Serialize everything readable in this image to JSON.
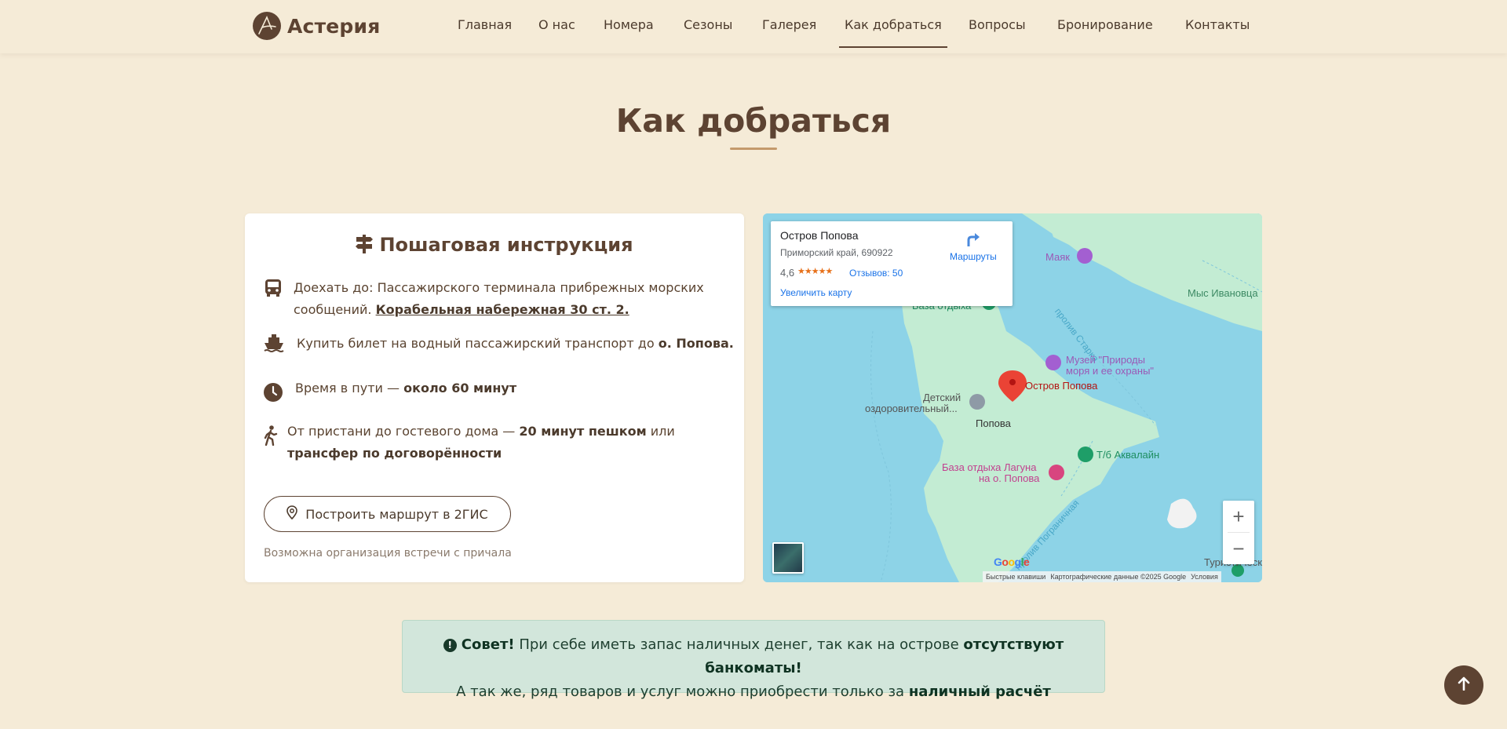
{
  "header": {
    "brand": "Астерия",
    "nav": [
      {
        "label": "Главная"
      },
      {
        "label": "О нас"
      },
      {
        "label": "Номера"
      },
      {
        "label": "Сезоны"
      },
      {
        "label": "Галерея"
      },
      {
        "label": "Как добраться",
        "active": true
      },
      {
        "label": "Вопросы"
      },
      {
        "label": "Бронирование"
      },
      {
        "label": "Контакты"
      }
    ]
  },
  "page": {
    "title": "Как добраться"
  },
  "instructions": {
    "title": "Пошаговая инструкция",
    "step1": {
      "text": "Доехать до: Пассажирского терминала прибрежных морских сообщений. ",
      "link": "Корабельная набережная 30 ст. 2."
    },
    "step2": {
      "text": "Купить билет на водный пассажирский транспорт до ",
      "bold": "о. Попова."
    },
    "step3": {
      "text": "Время в пути — ",
      "bold": "около 60 минут"
    },
    "step4": {
      "text": "От пристани до гостевого дома — ",
      "bold1": "20 минут пешком",
      "mid": " или ",
      "bold2": "трансфер по договорённости"
    },
    "route_button": "Построить маршрут в 2ГИС",
    "note": "Возможна организация встречи с причала"
  },
  "map": {
    "info": {
      "title": "Остров Попова",
      "address": "Приморский край, 690922",
      "rating": "4,6",
      "stars": "★★★★★",
      "reviews": "Отзывов: 50",
      "enlarge": "Увеличить карту",
      "routes": "Маршруты"
    },
    "labels": {
      "lighthouse": "Маяк",
      "cape": "Мыс Ивановца",
      "strait": "пролив Старка",
      "base_top": "База отдыха",
      "museum1": "Музей \"Природы",
      "museum2": "моря и ее охраны\"",
      "island_pin": "Остров Попова",
      "camp1": "Детский",
      "camp2": "оздоровительный...",
      "village": "Попова",
      "akvalain": "Т/б Аквалайн",
      "laguna1": "База отдыха Лагуна",
      "laguna2": "на о. Попова",
      "border_strait": "пролив Пограничная",
      "tourist": "Туристическ..."
    },
    "attribution": {
      "shortcuts": "Быстрые клавиши",
      "data": "Картографические данные ©2025 Google",
      "terms": "Условия"
    },
    "zoom_in": "+",
    "zoom_out": "−"
  },
  "tip": {
    "lead": "Совет!",
    "text1": " При себе иметь запас наличных денег, так как на острове ",
    "bold1": "отсутствуют банкоматы!",
    "text2": "А так же, ряд товаров и услуг можно приобрести только за ",
    "bold2": "наличный расчёт"
  },
  "colors": {
    "brand": "#5d4332",
    "background": "#f5ebd7",
    "accent": "#c49a6c",
    "tip_bg": "#d2e6db"
  }
}
